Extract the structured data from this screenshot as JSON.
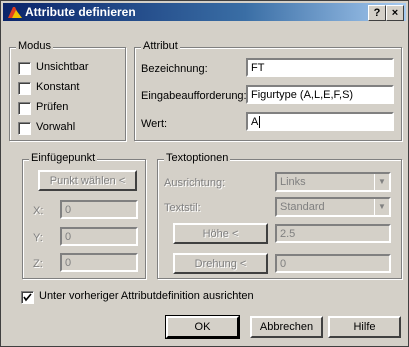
{
  "window": {
    "title": "Attribute definieren",
    "help_btn": "?",
    "close_btn": "×"
  },
  "modus": {
    "legend": "Modus",
    "items": [
      {
        "label": "Unsichtbar",
        "checked": false
      },
      {
        "label": "Konstant",
        "checked": false
      },
      {
        "label": "Prüfen",
        "checked": false
      },
      {
        "label": "Vorwahl",
        "checked": false
      }
    ]
  },
  "attribut": {
    "legend": "Attribut",
    "bezeichnung_label": "Bezeichnung:",
    "bezeichnung_value": "FT",
    "eingabe_label": "Eingabeaufforderung:",
    "eingabe_value": "Figurtype (A,L,E,F,S)",
    "wert_label": "Wert:",
    "wert_value": "A"
  },
  "einfuegepunkt": {
    "legend": "Einfügepunkt",
    "pick_button": "Punkt wählen <",
    "x_label": "X:",
    "x_value": "0",
    "y_label": "Y:",
    "y_value": "0",
    "z_label": "Z:",
    "z_value": "0"
  },
  "textoptionen": {
    "legend": "Textoptionen",
    "ausrichtung_label": "Ausrichtung:",
    "ausrichtung_value": "Links",
    "textstil_label": "Textstil:",
    "textstil_value": "Standard",
    "hoehe_button": "Höhe <",
    "hoehe_value": "2.5",
    "drehung_button": "Drehung <",
    "drehung_value": "0"
  },
  "align_checkbox": {
    "label": "Unter vorheriger Attributdefinition ausrichten",
    "checked": true
  },
  "buttons": {
    "ok": "OK",
    "cancel": "Abbrechen",
    "help": "Hilfe"
  }
}
